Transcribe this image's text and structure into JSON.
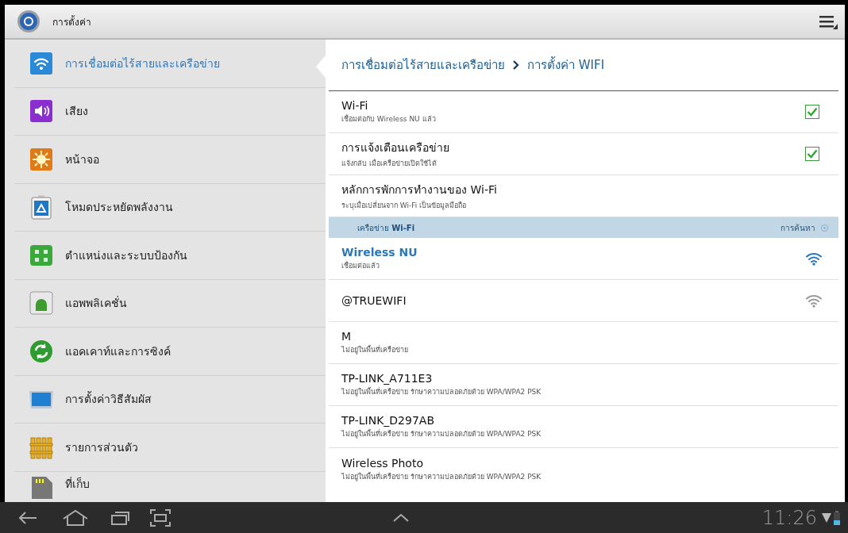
{
  "app_bar": {
    "title": "การตั้งค่า"
  },
  "sidebar": {
    "items": [
      {
        "label": "การเชื่อมต่อไร้สายและเครือข่าย",
        "selected": true
      },
      {
        "label": "เสียง",
        "selected": false
      },
      {
        "label": "หน้าจอ",
        "selected": false
      },
      {
        "label": "โหมดประหยัดพลังงาน",
        "selected": false
      },
      {
        "label": "ตำแหน่งและระบบป้องกัน",
        "selected": false
      },
      {
        "label": "แอพพลิเคชั่น",
        "selected": false
      },
      {
        "label": "แอคเคาท์และการซิงค์",
        "selected": false
      },
      {
        "label": "การตั้งค่าวิธีสัมผัส",
        "selected": false
      },
      {
        "label": "รายการส่วนตัว",
        "selected": false
      },
      {
        "label": "ที่เก็บ",
        "selected": false
      }
    ]
  },
  "breadcrumb": {
    "parent": "การเชื่อมต่อไร้สายและเครือข่าย",
    "current": "การตั้งค่า WIFI"
  },
  "settings": [
    {
      "kind": "checkbox",
      "title": "Wi-Fi",
      "summary": "เชื่อมต่อกับ Wireless NU แล้ว",
      "checked": true
    },
    {
      "kind": "checkbox",
      "title": "การแจ้งเตือนเครือข่าย",
      "summary": "แจ้งกลับ เมื่อเครือข่ายเปิดใช้ได้",
      "checked": true
    },
    {
      "kind": "plain",
      "title": "หลักการพักการทำงานของ Wi-Fi",
      "summary": "ระบุเมื่อเปลี่ยนจาก Wi-Fi เป็นข้อมูลมือถือ"
    }
  ],
  "network_section": {
    "title": "เครือข่าย **Wi-Fi**",
    "action": "การค้นหา"
  },
  "networks": [
    {
      "name": "Wireless NU",
      "status": "เชื่อมต่อแล้ว",
      "connected": true,
      "in_range": true
    },
    {
      "name": "@TRUEWIFI",
      "connected": false,
      "in_range": true
    },
    {
      "name": "M",
      "status": "ไม่อยู่ในพื้นที่เครือข่าย",
      "connected": false,
      "in_range": false
    },
    {
      "name": "TP-LINK_A711E3",
      "status": "ไม่อยู่ในพื้นที่เครือข่าย รักษาความปลอดภัยด้วย WPA/WPA2 PSK",
      "connected": false,
      "in_range": false
    },
    {
      "name": "TP-LINK_D297AB",
      "status": "ไม่อยู่ในพื้นที่เครือข่าย รักษาความปลอดภัยด้วย WPA/WPA2 PSK",
      "connected": false,
      "in_range": false
    },
    {
      "name": "Wireless Photo",
      "status": "ไม่อยู่ในพื้นที่เครือข่าย รักษาความปลอดภัยด้วย WPA/WPA2 PSK",
      "connected": false,
      "in_range": false
    }
  ],
  "status_bar": {
    "time": "11:26"
  }
}
